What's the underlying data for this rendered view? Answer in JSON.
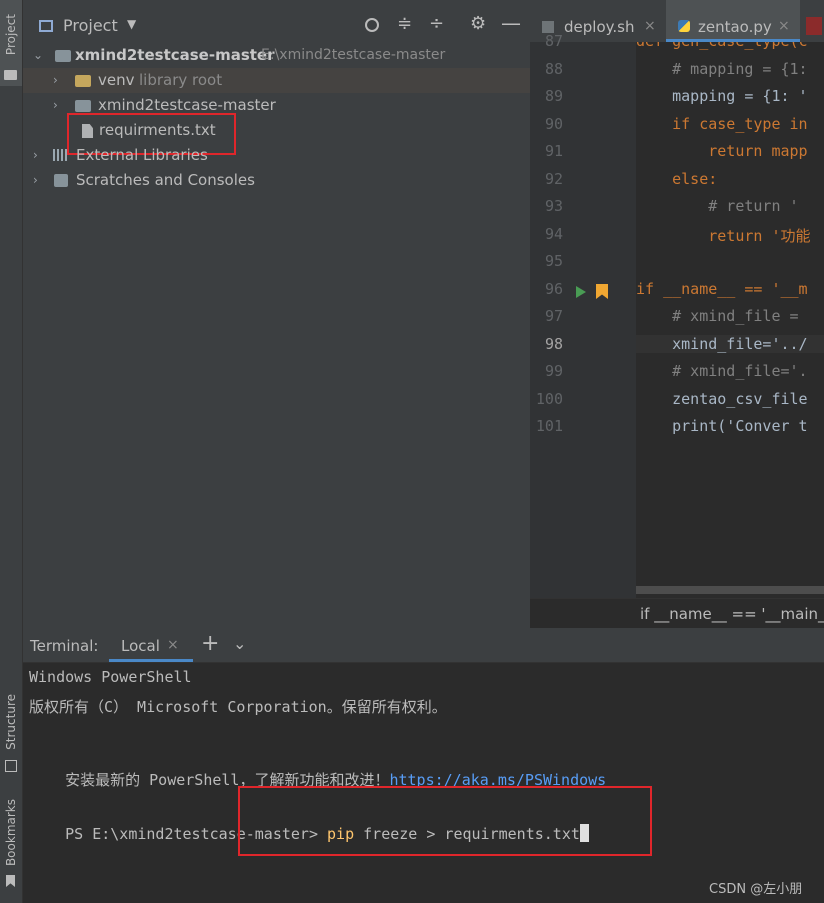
{
  "left_strip": {
    "project_label": "Project",
    "structure_label": "Structure",
    "bookmarks_label": "Bookmarks"
  },
  "project_panel": {
    "title": "Project",
    "tree": [
      {
        "label": "xmind2testcase-master",
        "hint": "E:\\xmind2testcase-master"
      },
      {
        "label": "venv",
        "hint": "library root"
      },
      {
        "label": "xmind2testcase-master",
        "hint": ""
      },
      {
        "label": "requirments.txt",
        "hint": ""
      },
      {
        "label": "External Libraries",
        "hint": ""
      },
      {
        "label": "Scratches and Consoles",
        "hint": ""
      }
    ]
  },
  "editor": {
    "tabs": [
      {
        "label": "deploy.sh"
      },
      {
        "label": "zentao.py"
      }
    ],
    "line_numbers": [
      "87",
      "88",
      "89",
      "90",
      "91",
      "92",
      "93",
      "94",
      "95",
      "96",
      "97",
      "98",
      "99",
      "100",
      "101"
    ],
    "code_lines": [
      "def gen_case_type(c",
      "    # mapping = {1:",
      "    mapping = {1: '",
      "    if case_type in",
      "        return mapp",
      "    else:",
      "        # return '",
      "        return '功能",
      "",
      "if __name__ == '__m",
      "    # xmind_file =",
      "    xmind_file='../",
      "    # xmind_file='.",
      "    zentao_csv_file",
      "    print('Conver t"
    ],
    "breadcrumb": "if __name__ == '__main__'"
  },
  "terminal": {
    "title": "Terminal:",
    "tab_label": "Local",
    "lines": [
      "Windows PowerShell",
      "版权所有（C） Microsoft Corporation。保留所有权利。",
      "",
      "安装最新的 PowerShell，了解新功能和改进！",
      "",
      "PS E:\\xmind2testcase-master> "
    ],
    "link": "https://aka.ms/PSWindows",
    "command_pip": "pip",
    "command_rest": " freeze > requirments.txt"
  },
  "watermark": "CSDN @左小朋",
  "colors": {
    "keyword": "#cc7832",
    "comment": "#808080",
    "string": "#6a8759",
    "link": "#589df6",
    "highlight": "#e0262b",
    "pip": "#ffc66d"
  }
}
